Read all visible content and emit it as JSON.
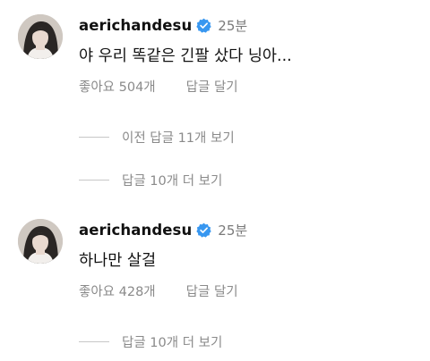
{
  "comments": [
    {
      "username": "aerichandesu",
      "time": "25분",
      "text": "야 우리 똑같은 긴팔 샀다 닝아...",
      "likes": "좋아요 504개",
      "reply": "답글 달기"
    },
    {
      "username": "aerichandesu",
      "time": "25분",
      "text": "하나만 살걸",
      "likes": "좋아요 428개",
      "reply": "답글 달기"
    }
  ],
  "threads": {
    "prev_replies": "이전 답글 11개 보기",
    "more_replies_1": "답글 10개 더 보기",
    "more_replies_2": "답글 10개 더 보기"
  },
  "icons": {
    "verified": "verified-badge-icon",
    "avatar": "profile-photo"
  },
  "colors": {
    "verified_blue": "#3897f0",
    "secondary_text": "#8a8a8a",
    "primary_text": "#111111"
  }
}
